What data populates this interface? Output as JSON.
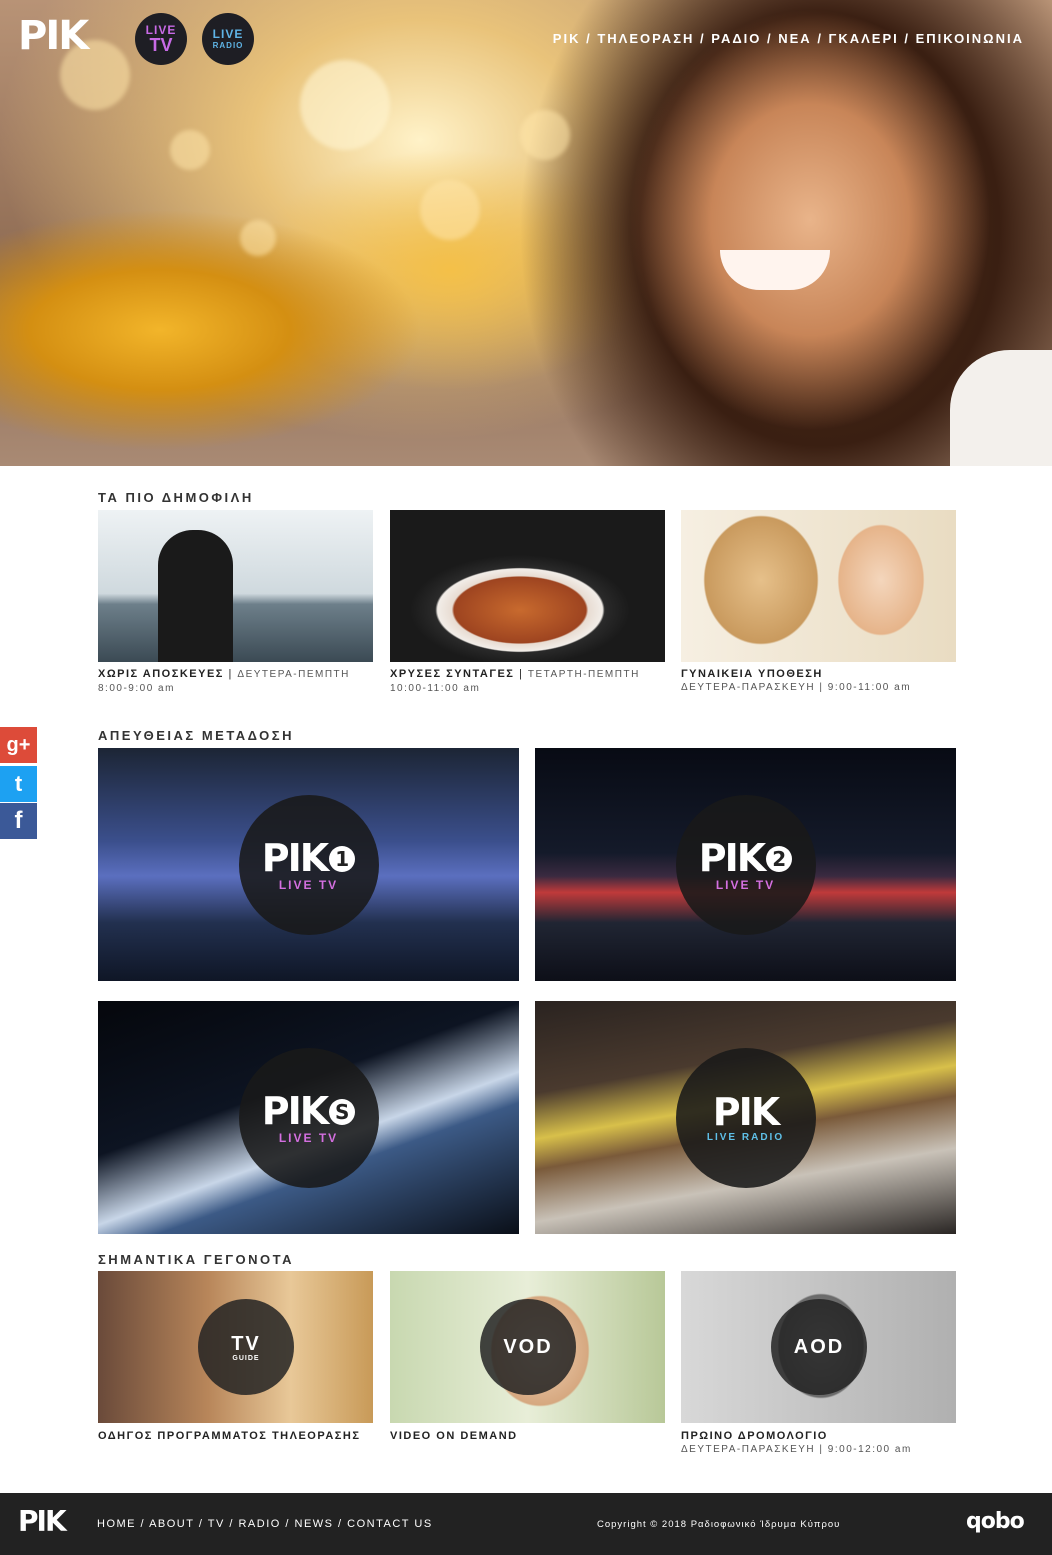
{
  "header": {
    "logo": "ΡΙΚ",
    "live_tv": {
      "line1": "LIVE",
      "line2": "TV"
    },
    "live_radio": {
      "line1": "LIVE",
      "line2": "RADIO"
    },
    "nav": [
      "ΡΙΚ",
      "ΤΗΛΕΟΡΑΣΗ",
      "ΡΑΔΙΟ",
      "ΝΕΑ",
      "ΓΚΑΛΕΡΙ",
      "ΕΠΙΚΟΙΝΩΝΙΑ"
    ],
    "nav_separator": " / "
  },
  "popular": {
    "title": "ΤΑ ΠΙΟ ΔΗΜΟΦΙΛΗ",
    "items": [
      {
        "title": "ΧΩΡΙΣ ΑΠΟΣΚΕΥΕΣ",
        "days": "ΔΕΥΤΕΡΑ-ΠΕΜΠΤΗ",
        "time": "8:00-9:00 am"
      },
      {
        "title": "ΧΡΥΣΕΣ ΣΥΝΤΑΓΕΣ",
        "days": "ΤΕΤΑΡΤΗ-ΠΕΜΠΤΗ",
        "time": "10:00-11:00 am"
      },
      {
        "title": "ΓΥΝΑΙΚΕΙΑ ΥΠΟΘΕΣΗ",
        "days": "ΔΕΥΤΕΡΑ-ΠΑΡΑΣΚΕΥΗ",
        "time": "9:00-11:00 am"
      }
    ]
  },
  "live": {
    "title": "ΑΠΕΥΘΕΙΑΣ ΜΕΤΑΔΟΣΗ",
    "channels": [
      {
        "logo": "ΡΙΚ",
        "num": "1",
        "label": "LIVE TV",
        "color": "#d46fe0"
      },
      {
        "logo": "ΡΙΚ",
        "num": "2",
        "label": "LIVE TV",
        "color": "#d46fe0"
      },
      {
        "logo": "ΡΙΚ",
        "num": "S",
        "label": "LIVE TV",
        "color": "#d46fe0"
      },
      {
        "logo": "ΡΙΚ",
        "num": "",
        "label": "LIVE RADIO",
        "color": "#5fc0e8"
      }
    ]
  },
  "events": {
    "title": "ΣΗΜΑΝΤΙΚΑ ΓΕΓΟΝΟΤΑ",
    "items": [
      {
        "badge": "TV",
        "badge_sub": "GUIDE",
        "title": "ΟΔΗΓΟΣ ΠΡΟΓΡΑΜΜΑΤΟΣ ΤΗΛΕΟΡΑΣΗΣ",
        "days": "",
        "time": ""
      },
      {
        "badge": "VOD",
        "badge_sub": "",
        "title": "VIDEO ON DEMAND",
        "days": "",
        "time": ""
      },
      {
        "badge": "AOD",
        "badge_sub": "",
        "title": "ΠΡΩΙΝΟ ΔΡΟΜΟΛΟΓΙΟ",
        "days": "ΔΕΥΤΕΡΑ-ΠΑΡΑΣΚΕΥΗ",
        "time": "9:00-12:00 am"
      }
    ]
  },
  "social": [
    {
      "icon": "google-plus-icon",
      "glyph": "g+",
      "color": "#dd4b39"
    },
    {
      "icon": "twitter-icon",
      "glyph": "t",
      "color": "#1da1f2"
    },
    {
      "icon": "facebook-icon",
      "glyph": "f",
      "color": "#3b5998"
    }
  ],
  "footer": {
    "logo": "ΡΙΚ",
    "nav": [
      "HOME",
      "ABOUT",
      "TV",
      "RADIO",
      "NEWS",
      "CONTACT US"
    ],
    "nav_separator": " / ",
    "copyright": "Copyright © 2018 Ραδιοφωνικό Ίδρυμα Κύπρου",
    "credit": "qobo"
  }
}
